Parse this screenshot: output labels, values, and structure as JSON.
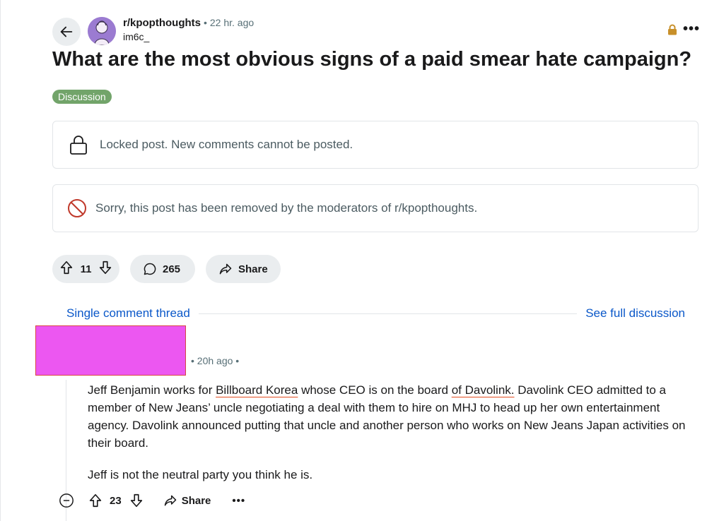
{
  "post": {
    "subreddit": "r/kpopthoughts",
    "separator": "•",
    "time": "22 hr. ago",
    "author": "im6c_",
    "more": "•••",
    "title": "What are the most obvious signs of a paid smear hate campaign?",
    "flair": "Discussion",
    "locked_notice": "Locked post. New comments cannot be posted.",
    "removed_notice": "Sorry, this post has been removed by the moderators of r/kpopthoughts.",
    "upvotes": "11",
    "comments": "265",
    "share": "Share"
  },
  "thread": {
    "single_label": "Single comment thread",
    "full_label": "See full discussion"
  },
  "comment": {
    "meta": "• 20h ago •",
    "paragraph1": {
      "t1": "Jeff Benjamin works for ",
      "u1": "Billboard Korea",
      "t2": " whose CEO is on the board ",
      "u2": "of Davolink.",
      "t3": " Davolink CEO admitted to a member of New Jeans’ uncle negotiating a deal with them to hire on MHJ to head up her own entertainment agency. Davolink announced putting that uncle and another person who works on New Jeans Japan activities on their board."
    },
    "paragraph2": "Jeff is not the neutral party you think he is.",
    "score": "23",
    "share": "Share",
    "more": "•••"
  },
  "icons": {
    "back": "arrow-left-icon",
    "lock": "lock-icon",
    "removed": "no-entry-icon",
    "upvote": "arrow-up-icon",
    "downvote": "arrow-down-icon",
    "comment": "speech-bubble-icon",
    "share": "share-arrow-icon",
    "collapse": "minus-circle-icon"
  },
  "colors": {
    "flair": "#72a46a",
    "link": "#0b58c9",
    "redaction": "#ec57f1",
    "lock_badge": "#c8902a",
    "removed_icon": "#c0392b"
  }
}
